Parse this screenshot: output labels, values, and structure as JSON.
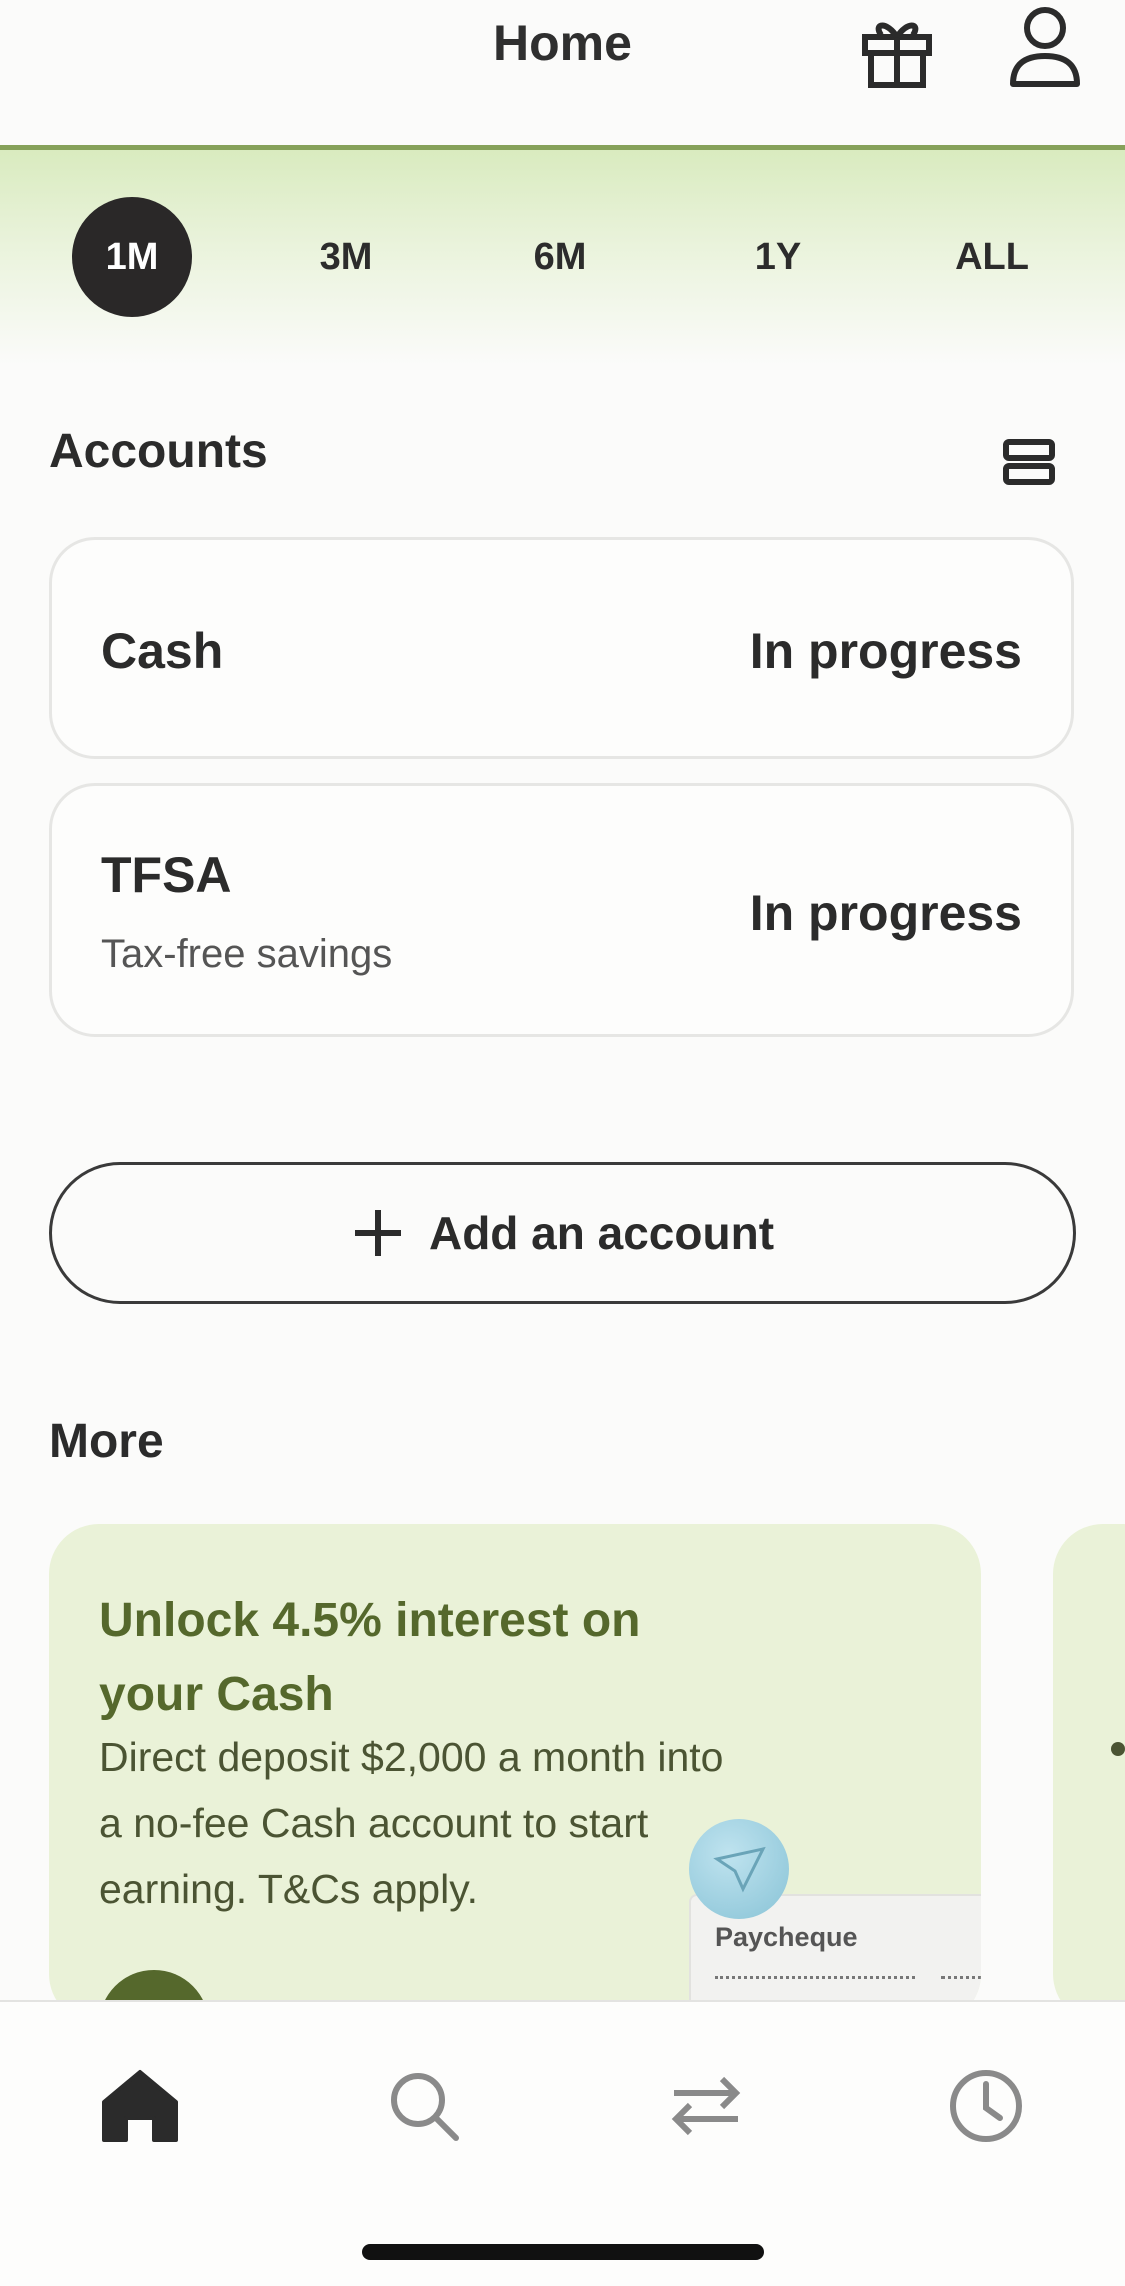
{
  "header": {
    "title": "Home"
  },
  "icons": {
    "gift": "gift-icon",
    "profile": "profile-icon",
    "list_view": "list-view-icon",
    "plus": "plus-icon",
    "home": "home-icon",
    "search": "search-icon",
    "transfer": "transfer-icon",
    "history": "clock-icon"
  },
  "colors": {
    "accent_green": "#86a15a",
    "active_pill": "#2a2828",
    "promo_bg": "#eaf2d8",
    "promo_title": "#55682c"
  },
  "time_ranges": {
    "selected": "1M",
    "items": [
      "1M",
      "3M",
      "6M",
      "1Y",
      "ALL"
    ]
  },
  "accounts": {
    "title": "Accounts",
    "items": [
      {
        "name": "Cash",
        "subtitle": "",
        "status": "In progress"
      },
      {
        "name": "TFSA",
        "subtitle": "Tax-free savings",
        "status": "In progress"
      }
    ],
    "add_label": "Add an account"
  },
  "more": {
    "title": "More",
    "promo": {
      "title": "Unlock 4.5% interest on your Cash",
      "body": "Direct deposit $2,000 a month into a no-fee Cash account to start earning. T&Cs apply.",
      "illustration_label": "Paycheque"
    }
  }
}
